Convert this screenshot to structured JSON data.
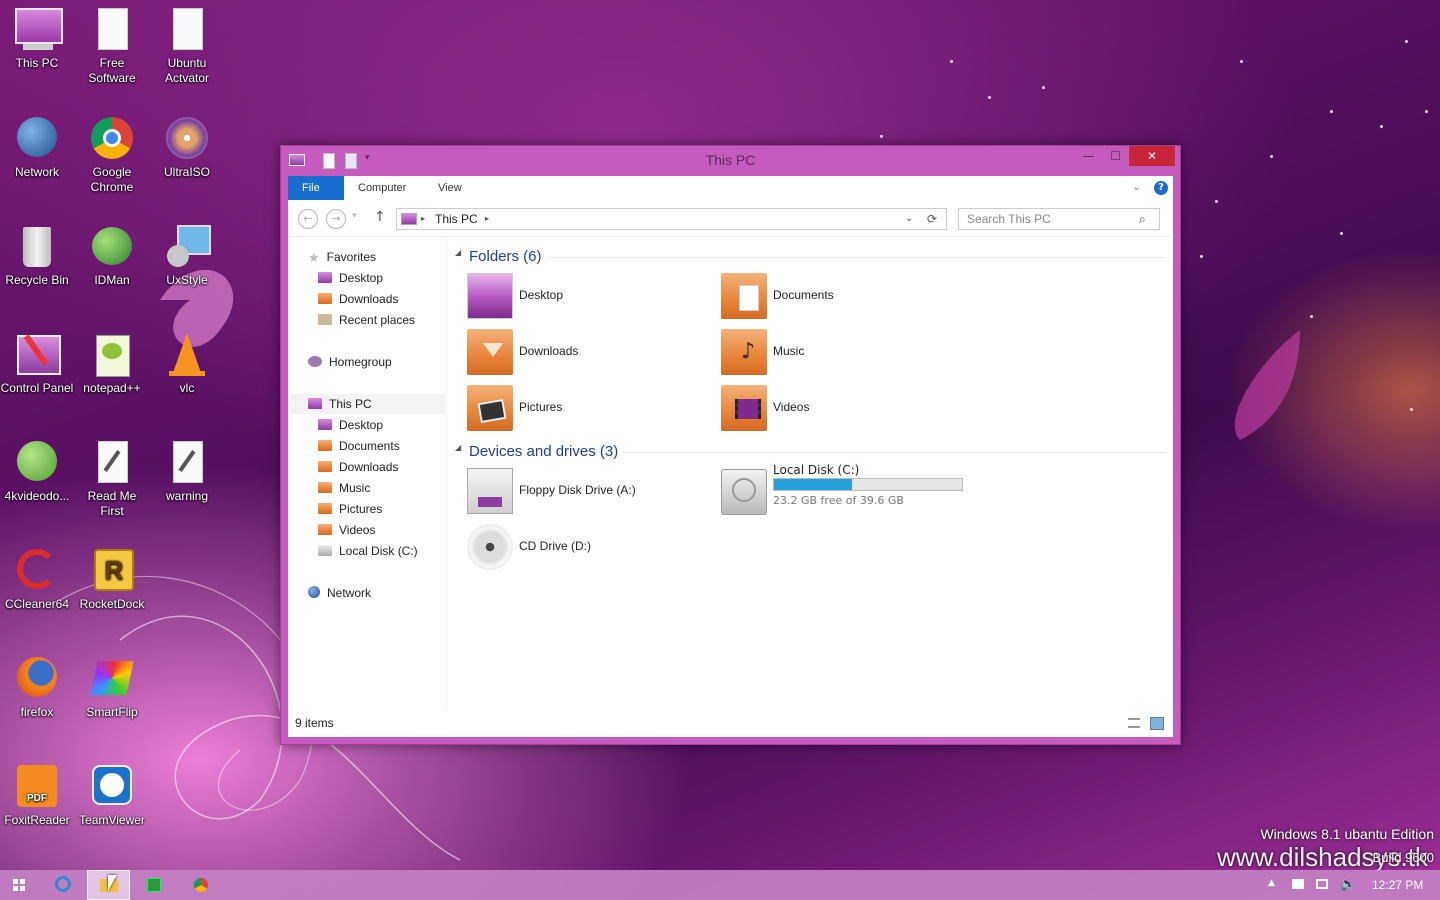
{
  "desktop": {
    "icons": [
      {
        "label": "This PC",
        "icon": "computer-icon"
      },
      {
        "label": "Free Software",
        "icon": "document-icon"
      },
      {
        "label": "Ubuntu Actvator",
        "icon": "document-icon"
      },
      {
        "label": "Network",
        "icon": "network-globe-icon"
      },
      {
        "label": "Google Chrome",
        "icon": "chrome-icon"
      },
      {
        "label": "UltraISO",
        "icon": "disc-icon"
      },
      {
        "label": "Recycle Bin",
        "icon": "recycle-bin-icon"
      },
      {
        "label": "IDMan",
        "icon": "idm-icon"
      },
      {
        "label": "UxStyle",
        "icon": "uxstyle-icon"
      },
      {
        "label": "Control Panel",
        "icon": "control-panel-icon"
      },
      {
        "label": "notepad++",
        "icon": "notepadpp-icon"
      },
      {
        "label": "vlc",
        "icon": "vlc-cone-icon"
      },
      {
        "label": "4kvideodo...",
        "icon": "4kvideo-icon"
      },
      {
        "label": "Read Me First",
        "icon": "document-pen-icon"
      },
      {
        "label": "warning",
        "icon": "document-pen-icon"
      },
      {
        "label": "CCleaner64",
        "icon": "ccleaner-icon"
      },
      {
        "label": "RocketDock",
        "icon": "rocketdock-icon"
      },
      {
        "label": "firefox",
        "icon": "firefox-icon"
      },
      {
        "label": "SmartFlip",
        "icon": "smartflip-icon"
      },
      {
        "label": "FoxitReader",
        "icon": "foxit-pdf-icon"
      },
      {
        "label": "TeamViewer",
        "icon": "teamviewer-icon"
      }
    ],
    "watermark_line1": "Windows 8.1 ubantu Edition",
    "watermark_line2": "www.dilshadsys.tk",
    "build": "Build 9600"
  },
  "window": {
    "title": "This PC",
    "ribbon_tabs": [
      "File",
      "Computer",
      "View"
    ],
    "address": {
      "root_icon": "computer-icon",
      "location": "This PC"
    },
    "search_placeholder": "Search This PC",
    "nav_pane": {
      "favorites": {
        "label": "Favorites",
        "items": [
          "Desktop",
          "Downloads",
          "Recent places"
        ]
      },
      "homegroup": "Homegroup",
      "this_pc": {
        "label": "This PC",
        "items": [
          "Desktop",
          "Documents",
          "Downloads",
          "Music",
          "Pictures",
          "Videos",
          "Local Disk (C:)"
        ]
      },
      "network": "Network"
    },
    "folders_header": "Folders (6)",
    "folders": [
      "Desktop",
      "Documents",
      "Downloads",
      "Music",
      "Pictures",
      "Videos"
    ],
    "drives_header": "Devices and drives (3)",
    "drives": [
      {
        "name": "Floppy Disk Drive (A:)"
      },
      {
        "name": "Local Disk (C:)",
        "free_text": "23.2 GB free of 39.6 GB",
        "used_fraction": 0.414
      },
      {
        "name": "CD Drive (D:)"
      }
    ],
    "status": "9 items"
  },
  "taskbar": {
    "clock": "12:27 PM",
    "apps": [
      "start-icon",
      "ie-icon",
      "file-explorer-icon",
      "store-icon",
      "chrome-icon"
    ]
  },
  "colors": {
    "accent_blue": "#1a6dd0",
    "window_frame": "#c65bbf",
    "close_red": "#c7253a",
    "drive_bar": "#26a0da",
    "taskbar": "#c480c4"
  }
}
